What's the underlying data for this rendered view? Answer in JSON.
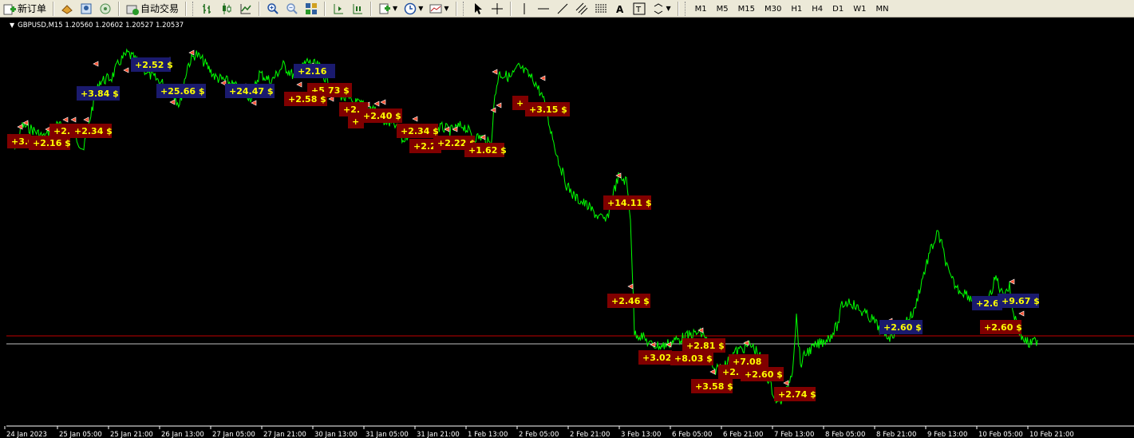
{
  "toolbar": {
    "new_order_label": "新订单",
    "autotrade_label": "自动交易",
    "timeframes": [
      "M1",
      "M5",
      "M15",
      "M30",
      "H1",
      "H4",
      "D1",
      "W1",
      "MN"
    ]
  },
  "chart": {
    "symbol_line": "GBPUSD,M15  1.20560 1.20602 1.20527 1.20537"
  },
  "chart_data": {
    "type": "line",
    "symbol": "GBPUSD",
    "timeframe": "M15",
    "ohlc": {
      "open": 1.2056,
      "high": 1.20602,
      "low": 1.20527,
      "close": 1.20537
    },
    "x_tick_labels": [
      "24 Jan 2023",
      "25 Jan 05:00",
      "25 Jan 21:00",
      "26 Jan 13:00",
      "27 Jan 05:00",
      "27 Jan 21:00",
      "30 Jan 13:00",
      "31 Jan 05:00",
      "31 Jan 21:00",
      "1 Feb 13:00",
      "2 Feb 05:00",
      "2 Feb 21:00",
      "3 Feb 13:00",
      "6 Feb 05:00",
      "6 Feb 21:00",
      "7 Feb 13:00",
      "8 Feb 05:00",
      "8 Feb 21:00",
      "9 Feb 13:00",
      "10 Feb 05:00",
      "10 Feb 21:00"
    ],
    "price_series_color": "#00ff00",
    "grid": false,
    "trade_labels": [
      {
        "text": "+3.0",
        "color": "#800000"
      },
      {
        "text": "+2.16 $",
        "color": "#800000"
      },
      {
        "text": "+2.",
        "color": "#800000"
      },
      {
        "text": "+2.34 $",
        "color": "#800000"
      },
      {
        "text": "+3.84 $",
        "color": "#1a1a6e"
      },
      {
        "text": "+2.52 $",
        "color": "#1a1a6e"
      },
      {
        "text": "+25.66 $",
        "color": "#1a1a6e"
      },
      {
        "text": "+24.47 $",
        "color": "#1a1a6e"
      },
      {
        "text": "+2.16",
        "color": "#1a1a6e"
      },
      {
        "text": "+5.73 $",
        "color": "#800000"
      },
      {
        "text": "+2.58 $",
        "color": "#800000"
      },
      {
        "text": "+2.",
        "color": "#800000"
      },
      {
        "text": "+2.40 $",
        "color": "#800000"
      },
      {
        "text": "+",
        "color": "#800000"
      },
      {
        "text": "+2.34 $",
        "color": "#800000"
      },
      {
        "text": "+2.2",
        "color": "#800000"
      },
      {
        "text": "+2.22 $",
        "color": "#800000"
      },
      {
        "text": "+1.62 $",
        "color": "#800000"
      },
      {
        "text": "+",
        "color": "#800000"
      },
      {
        "text": "+3.15 $",
        "color": "#800000"
      },
      {
        "text": "+14.11 $",
        "color": "#800000"
      },
      {
        "text": "+2.46 $",
        "color": "#800000"
      },
      {
        "text": "+3.02",
        "color": "#800000"
      },
      {
        "text": "+8.03 $",
        "color": "#800000"
      },
      {
        "text": "+2.81 $",
        "color": "#800000"
      },
      {
        "text": "+3.58 $",
        "color": "#800000"
      },
      {
        "text": "+2.",
        "color": "#800000"
      },
      {
        "text": "+7.08",
        "color": "#800000"
      },
      {
        "text": "+2.60 $",
        "color": "#800000"
      },
      {
        "text": "+2.74 $",
        "color": "#800000"
      },
      {
        "text": "+2.60 $",
        "color": "#1a1a6e"
      },
      {
        "text": "+2.6",
        "color": "#1a1a6e"
      },
      {
        "text": "+9.67 $",
        "color": "#1a1a6e"
      },
      {
        "text": "+2.60 $",
        "color": "#800000"
      }
    ],
    "horizontal_lines": [
      {
        "color": "#c00000"
      },
      {
        "color": "#c0c0c0"
      }
    ]
  }
}
